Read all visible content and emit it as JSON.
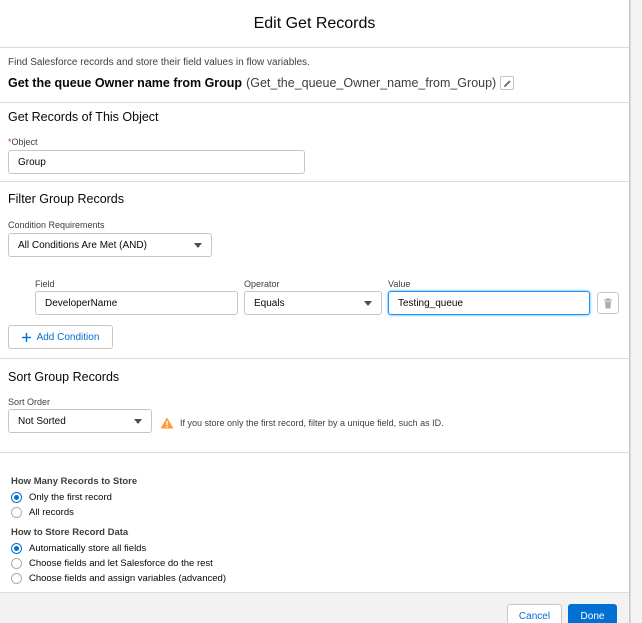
{
  "modal": {
    "title": "Edit Get Records",
    "intro": "Find Salesforce records and store their field values in flow variables.",
    "element_label": "Get the queue Owner name from Group",
    "element_api_name": "(Get_the_queue_Owner_name_from_Group)",
    "edit_icon": "pencil-icon"
  },
  "object_section": {
    "title": "Get Records of This Object",
    "required_marker": "*",
    "object_label": "Object",
    "object_value": "Group"
  },
  "filter_section": {
    "title": "Filter Group Records",
    "condition_label": "Condition Requirements",
    "condition_value": "All Conditions Are Met (AND)",
    "columns": {
      "field": "Field",
      "operator": "Operator",
      "value": "Value"
    },
    "row": {
      "field": "DeveloperName",
      "operator": "Equals",
      "value": "Testing_queue"
    },
    "delete_icon": "trash-icon",
    "add_icon": "plus-icon",
    "add_label": "Add Condition"
  },
  "sort_section": {
    "title": "Sort Group Records",
    "sort_label": "Sort Order",
    "sort_value": "Not Sorted",
    "warning_icon": "warning-icon",
    "warning_text": "If you store only the first record, filter by a unique field, such as ID."
  },
  "store_section": {
    "how_many_label": "How Many Records to Store",
    "how_many_options": [
      "Only the first record",
      "All records"
    ],
    "how_many_selected": 0,
    "how_store_label": "How to Store Record Data",
    "how_store_options": [
      "Automatically store all fields",
      "Choose fields and let Salesforce do the rest",
      "Choose fields and assign variables (advanced)"
    ],
    "how_store_selected": 0
  },
  "footer": {
    "cancel_label": "Cancel",
    "done_label": "Done"
  },
  "colors": {
    "brand": "#0070d2",
    "warning": "#ff9a3c",
    "focus": "#1b96ff"
  }
}
